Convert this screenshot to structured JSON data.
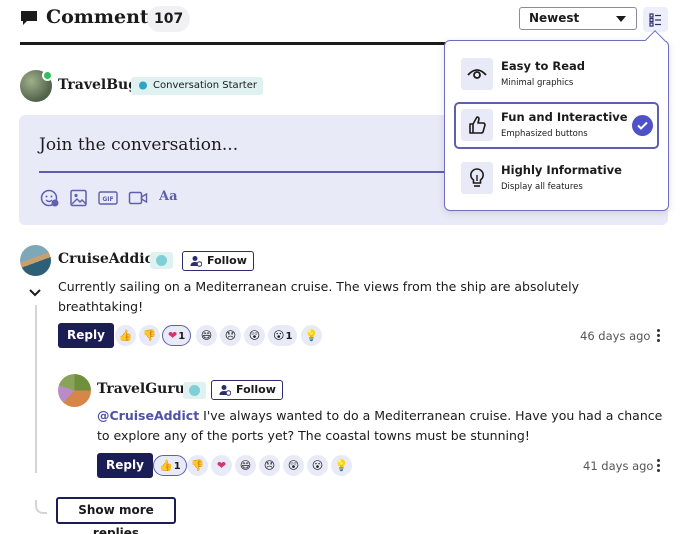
{
  "header": {
    "title": "Comments",
    "count": "107",
    "sort": "Newest"
  },
  "current_user": {
    "name": "TravelBug",
    "badge": "Conversation Starter"
  },
  "composer": {
    "placeholder": "Join the conversation...",
    "gif_label": "GIF",
    "text_format_label": "Aa"
  },
  "comments": [
    {
      "author": "CruiseAddict",
      "follow_label": "Follow",
      "text": "Currently sailing on a Mediterranean cruise. The views from the ship are absolutely breathtaking!",
      "reply_label": "Reply",
      "timestamp": "46 days ago",
      "reactions": [
        {
          "icon": "👍",
          "count": ""
        },
        {
          "icon": "👎",
          "count": ""
        },
        {
          "icon": "❤",
          "count": "1"
        },
        {
          "icon": "😄",
          "count": ""
        },
        {
          "icon": "😞",
          "count": ""
        },
        {
          "icon": "😲",
          "count": ""
        },
        {
          "icon": "😮",
          "count": "1"
        },
        {
          "icon": "💡",
          "count": ""
        }
      ]
    },
    {
      "author": "TravelGuru",
      "follow_label": "Follow",
      "mention": "@CruiseAddict",
      "text_line1": " I've always wanted to do a Mediterranean cruise. Have you had a chance",
      "text_line2": "to explore any of the ports yet? The coastal towns must be stunning!",
      "reply_label": "Reply",
      "timestamp": "41 days ago",
      "reactions": [
        {
          "icon": "👍",
          "count": "1"
        },
        {
          "icon": "👎",
          "count": ""
        },
        {
          "icon": "❤",
          "count": ""
        },
        {
          "icon": "😄",
          "count": ""
        },
        {
          "icon": "😞",
          "count": ""
        },
        {
          "icon": "😲",
          "count": ""
        },
        {
          "icon": "😮",
          "count": ""
        },
        {
          "icon": "💡",
          "count": ""
        }
      ]
    }
  ],
  "show_more_label": "Show more replies",
  "view_menu": {
    "options": [
      {
        "title": "Easy to Read",
        "subtitle": "Minimal graphics",
        "icon": "eye-icon"
      },
      {
        "title": "Fun and Interactive",
        "subtitle": "Emphasized buttons",
        "icon": "thumbs-up-icon",
        "selected": true
      },
      {
        "title": "Highly Informative",
        "subtitle": "Display all features",
        "icon": "lightbulb-icon"
      }
    ]
  },
  "colors": {
    "accent": "#5e5fae",
    "primary_button": "#1b1d55",
    "composer_bg": "#e9eaf7",
    "badge_bg": "#dff1f0"
  }
}
